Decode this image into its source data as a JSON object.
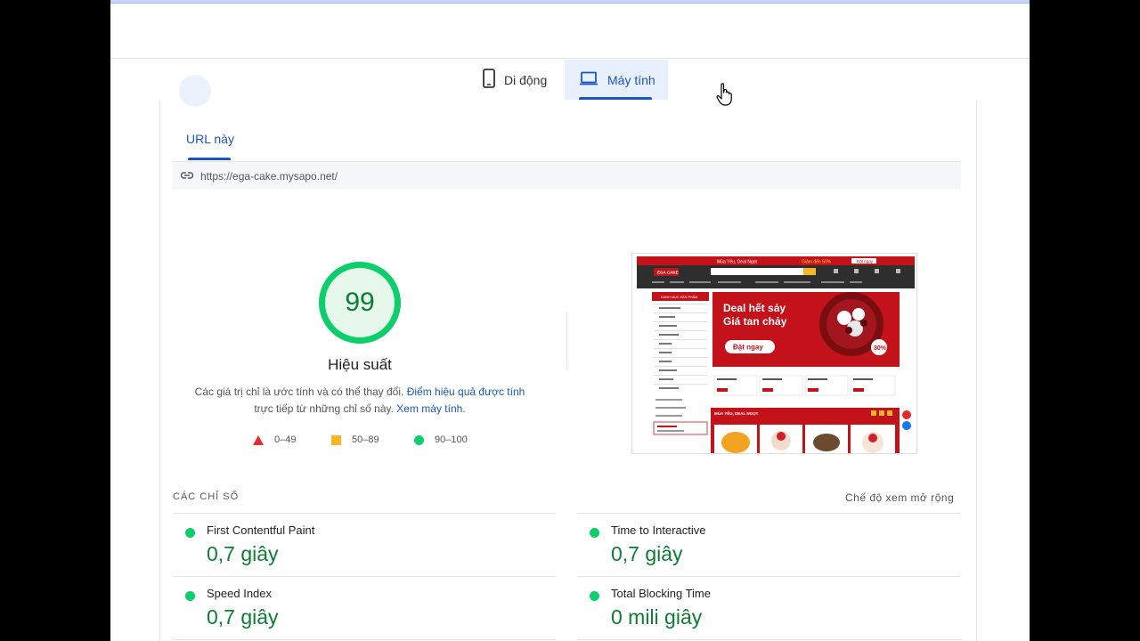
{
  "device_tabs": [
    {
      "label": "Di động",
      "icon": "smartphone-icon",
      "active": false
    },
    {
      "label": "Máy tính",
      "icon": "laptop-icon",
      "active": true
    }
  ],
  "url_tab": {
    "label": "URL này"
  },
  "url": "https://ega-cake.mysapo.net/",
  "performance": {
    "score": 99,
    "title": "Hiệu suất",
    "desc_part1": "Các giá trị chỉ là ước tính và có thể thay đổi. ",
    "desc_link1": "Điểm hiệu quả được tính",
    "desc_part2": " trực tiếp từ những chỉ số này. ",
    "desc_link2": "Xem máy tính",
    "desc_end": "."
  },
  "legend": [
    {
      "label": "0–49",
      "shape": "triangle",
      "color": "#e42a2a"
    },
    {
      "label": "50–89",
      "shape": "square",
      "color": "#f7b623"
    },
    {
      "label": "90–100",
      "shape": "circle",
      "color": "#0cce6b"
    }
  ],
  "thumbnail": {
    "logo": "EGA CAKE",
    "top_text": "Mùa Yêu, Deal Ngọt",
    "discount_text": "Giảm đến 50%",
    "order_button": "Đặt ngay",
    "category_header": "DANH MỤC SẢN PHẨM",
    "banner_line1": "Deal hết sảy",
    "banner_line2": "Giá tan chảy",
    "banner_button": "Đặt ngay",
    "banner_badge": "30%",
    "deals_title": "MÙA YÊU, DEAL NGỌT"
  },
  "metrics_label": "CÁC CHỈ SỐ",
  "expand_label": "Chế độ xem mở rộng",
  "metrics": [
    {
      "name": "First Contentful Paint",
      "value": "0,7 giây",
      "color": "#0cce6b"
    },
    {
      "name": "Time to Interactive",
      "value": "0,7 giây",
      "color": "#0cce6b"
    },
    {
      "name": "Speed Index",
      "value": "0,7 giây",
      "color": "#0cce6b"
    },
    {
      "name": "Total Blocking Time",
      "value": "0 mili giây",
      "color": "#0cce6b"
    }
  ],
  "colors": {
    "accent": "#1a56c2",
    "good": "#0cce6b",
    "good_text": "#0d7d33"
  }
}
